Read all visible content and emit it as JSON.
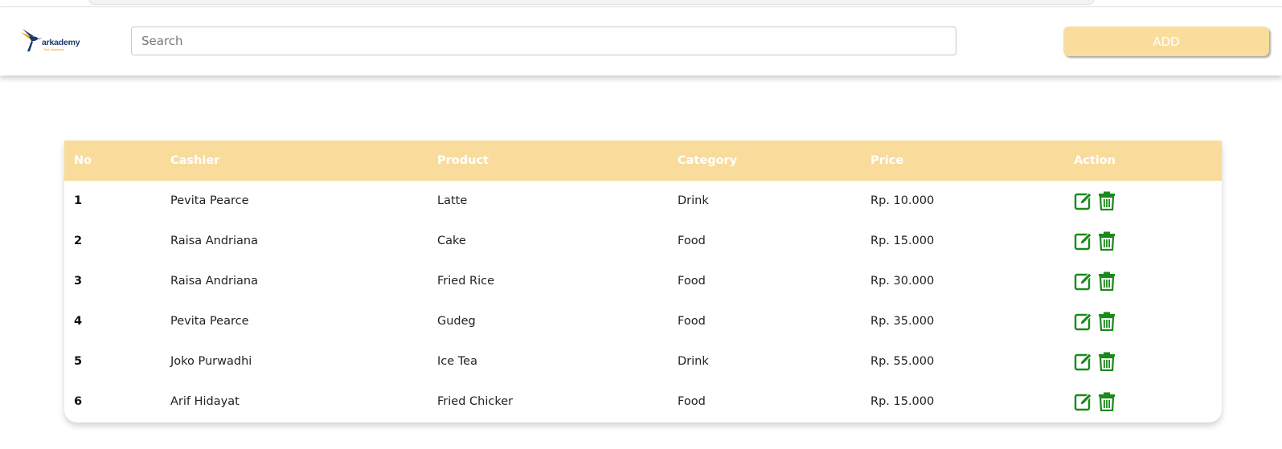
{
  "logo": {
    "text": "arkademy",
    "tagline": "Tech Academy"
  },
  "search": {
    "placeholder": "Search",
    "value": ""
  },
  "add_button": {
    "label": "ADD"
  },
  "table": {
    "headers": [
      "No",
      "Cashier",
      "Product",
      "Category",
      "Price",
      "Action"
    ],
    "rows": [
      {
        "no": "1",
        "cashier": "Pevita Pearce",
        "product": "Latte",
        "category": "Drink",
        "price": "Rp. 10.000"
      },
      {
        "no": "2",
        "cashier": "Raisa Andriana",
        "product": "Cake",
        "category": "Food",
        "price": "Rp. 15.000"
      },
      {
        "no": "3",
        "cashier": "Raisa Andriana",
        "product": "Fried Rice",
        "category": "Food",
        "price": "Rp. 30.000"
      },
      {
        "no": "4",
        "cashier": "Pevita Pearce",
        "product": "Gudeg",
        "category": "Food",
        "price": "Rp. 35.000"
      },
      {
        "no": "5",
        "cashier": "Joko Purwadhi",
        "product": "Ice Tea",
        "category": "Drink",
        "price": "Rp. 55.000"
      },
      {
        "no": "6",
        "cashier": "Arif Hidayat",
        "product": "Fried Chicker",
        "category": "Food",
        "price": "Rp. 15.000"
      }
    ],
    "action_icons": [
      "edit-icon",
      "trash-icon"
    ]
  },
  "colors": {
    "accent": "#f9dc9b",
    "action_icon": "#1a8a1a",
    "logo_blue": "#1a3a6b",
    "logo_orange": "#f0a000"
  }
}
